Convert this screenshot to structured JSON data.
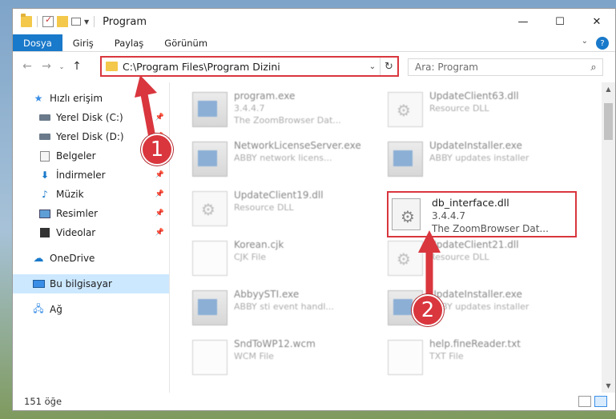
{
  "window": {
    "title": "Program",
    "controls": {
      "minimize": "—",
      "maximize": "☐",
      "close": "✕"
    }
  },
  "ribbon": {
    "tabs": [
      "Dosya",
      "Giriş",
      "Paylaş",
      "Görünüm"
    ],
    "help": "?"
  },
  "address": {
    "path": "C:\\Program Files\\Program Dizini",
    "search_placeholder": "Ara: Program"
  },
  "sidebar": {
    "items": [
      {
        "label": "Hızlı erişim",
        "icon": "star-icon"
      },
      {
        "label": "Yerel Disk (C:)",
        "icon": "disk-icon",
        "pinned": true
      },
      {
        "label": "Yerel Disk (D:)",
        "icon": "disk-icon",
        "pinned": true
      },
      {
        "label": "Belgeler",
        "icon": "documents-icon",
        "pinned": true
      },
      {
        "label": "İndirmeler",
        "icon": "download-icon",
        "pinned": true
      },
      {
        "label": "Müzik",
        "icon": "music-icon",
        "pinned": true
      },
      {
        "label": "Resimler",
        "icon": "pictures-icon",
        "pinned": true
      },
      {
        "label": "Videolar",
        "icon": "video-icon",
        "pinned": true
      },
      {
        "label": "OneDrive",
        "icon": "cloud-icon"
      },
      {
        "label": "Bu bilgisayar",
        "icon": "computer-icon",
        "selected": true
      },
      {
        "label": "Ağ",
        "icon": "network-icon"
      }
    ]
  },
  "files": [
    {
      "name": "program.exe",
      "line2": "3.4.4.7",
      "line3": "The ZoomBrowser Dat...",
      "type": "exe"
    },
    {
      "name": "UpdateClient63.dll",
      "line2": "Resource DLL",
      "type": "dll"
    },
    {
      "name": "NetworkLicenseServer.exe",
      "line2": "ABBY network licens...",
      "type": "exe"
    },
    {
      "name": "UpdateInstaller.exe",
      "line2": "ABBY updates installer",
      "type": "exe"
    },
    {
      "name": "UpdateClient19.dll",
      "line2": "Resource DLL",
      "type": "dll"
    },
    {
      "name": "Korean.cjk",
      "line2": "CJK File",
      "type": "doc"
    },
    {
      "name": "UpdateClient21.dll",
      "line2": "Resource DLL",
      "type": "dll"
    },
    {
      "name": "AbbyySTI.exe",
      "line2": "ABBY sti event handl...",
      "type": "exe"
    },
    {
      "name": "UpdateInstaller.exe",
      "line2": "ABBY updates installer",
      "type": "exe"
    },
    {
      "name": "SndToWP12.wcm",
      "line2": "WCM File",
      "type": "doc"
    },
    {
      "name": "help.fineReader.txt",
      "line2": "TXT File",
      "type": "doc"
    }
  ],
  "highlighted_file": {
    "name": "db_interface.dll",
    "version": "3.4.4.7",
    "description": "The ZoomBrowser Dat..."
  },
  "annotations": {
    "badge1": "1",
    "badge2": "2",
    "color": "#d9363e"
  },
  "status": {
    "count": "151 öğe"
  }
}
